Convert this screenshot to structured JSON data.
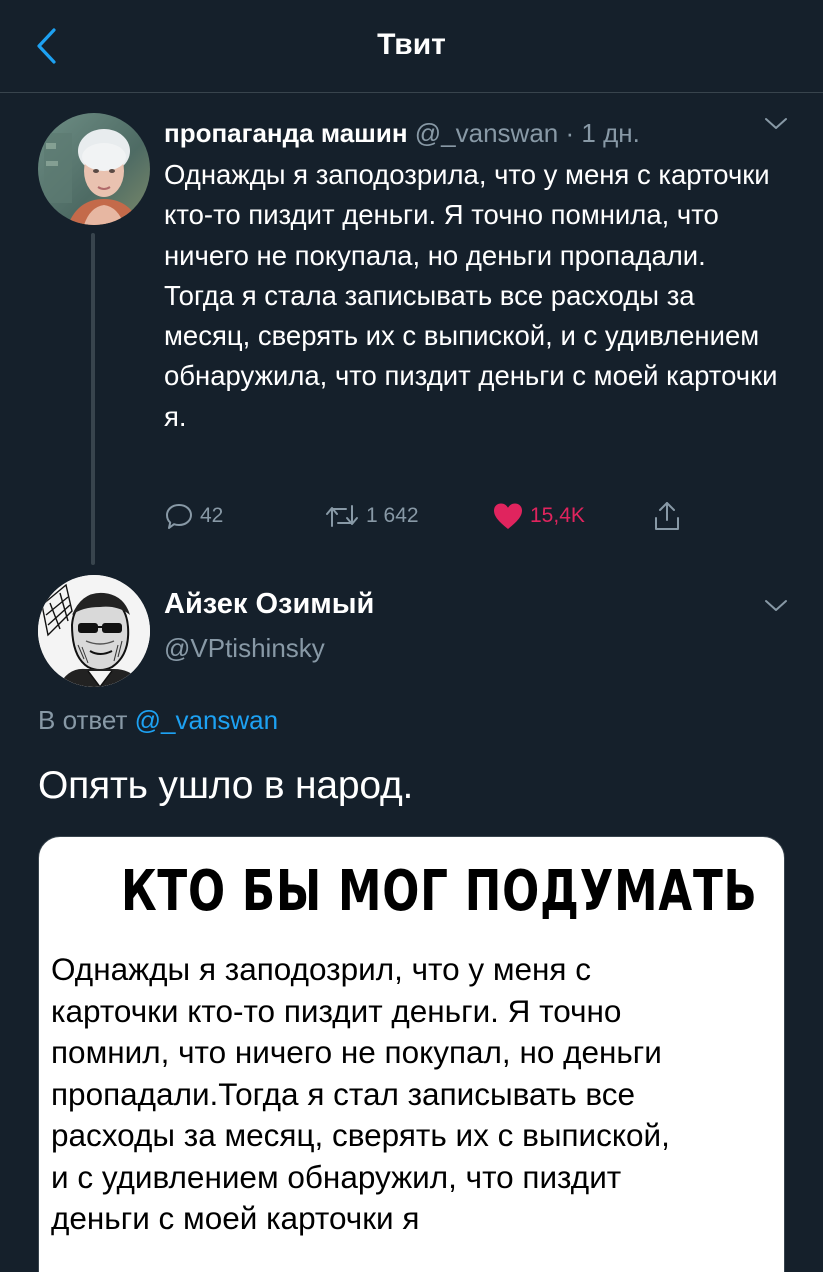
{
  "header": {
    "title": "Твит"
  },
  "parent_tweet": {
    "name": "пропаганда машин",
    "handle": "@_vanswan",
    "separator": "·",
    "time": "1 дн.",
    "text_paragraph_1": "Однажды я заподозрила, что у меня с карточки кто-то пиздит деньги. Я точно помнила, что ничего не покупала, но деньги пропадали.",
    "text_paragraph_2": "Тогда я стала записывать все расходы за месяц, сверять их с выпиской, и с удивлением обнаружила, что пиздит деньги с моей карточки я.",
    "replies": "42",
    "retweets": "1 642",
    "likes": "15,4K"
  },
  "main_tweet": {
    "name": "Айзек Озимый",
    "handle": "@VPtishinsky",
    "reply_prefix": "В ответ",
    "reply_handle": "@_vanswan",
    "text": "Опять ушло в народ."
  },
  "media": {
    "title": "КТО БЫ МОГ ПОДУМАТЬ",
    "lines": [
      "Однажды я заподозрил, что у меня с",
      "карточки кто-то пиздит деньги. Я точно",
      "помнил, что ничего не покупал, но деньги",
      "пропадали.Тогда я стал записывать все",
      "расходы за месяц, сверять их с выпиской,",
      "и с удивлением обнаружил, что пиздит",
      "деньги с моей карточки я"
    ]
  },
  "colors": {
    "background": "#15202b",
    "accent": "#1da1f2",
    "like": "#e0245e",
    "secondary_text": "#8899a6",
    "divider": "#38444d"
  },
  "icons": {
    "back": "chevron-left-icon",
    "more": "chevron-down-icon",
    "reply": "reply-bubble-icon",
    "retweet": "retweet-icon",
    "like": "heart-icon",
    "share": "share-icon"
  }
}
